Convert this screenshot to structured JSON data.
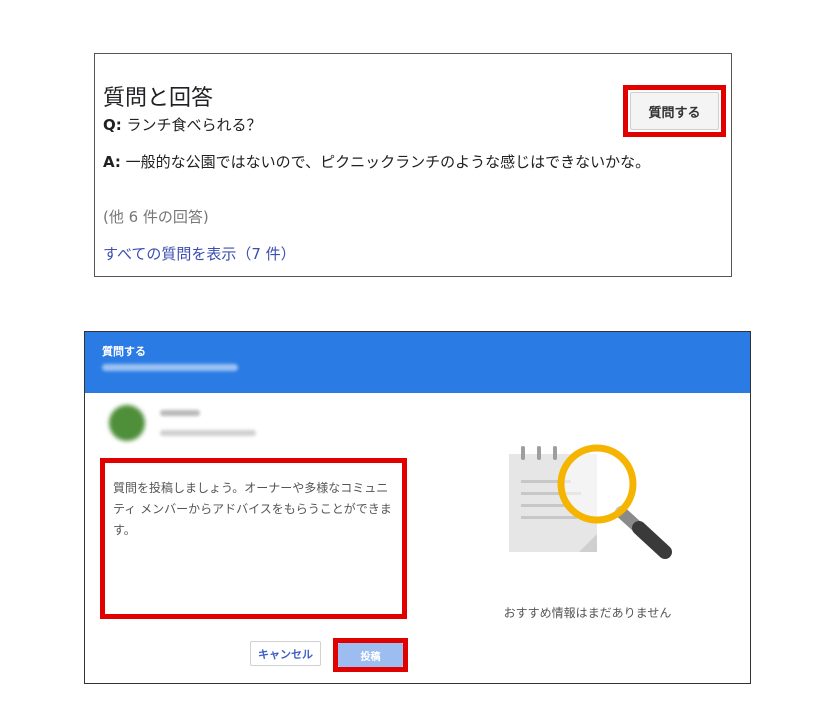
{
  "qa": {
    "title": "質問と回答",
    "ask_button": "質問する",
    "question_prefix": "Q:",
    "question_text": "ランチ食べられる？",
    "answer_prefix": "A:",
    "answer_text": "一般的な公園ではないので、ピクニックランチのような感じはできないかな。",
    "more_answers": "(他 6 件の回答)",
    "all_questions_link": "すべての質問を表示（7 件）"
  },
  "dialog": {
    "title": "質問する",
    "textarea_placeholder": "質問を投稿しましょう。オーナーや多様なコミュニティ メンバーからアドバイスをもらうことができます。",
    "cancel_label": "キャンセル",
    "post_label": "投稿",
    "no_recommendations": "おすすめ情報はまだありません"
  },
  "colors": {
    "header_blue": "#2a7be4",
    "highlight_red": "#e00000",
    "link_blue": "#3c4fb0",
    "post_button": "#9dbcf0",
    "magnifier_ring": "#f4b400"
  },
  "icons": {
    "illustration": "magnifying-glass-over-document"
  }
}
